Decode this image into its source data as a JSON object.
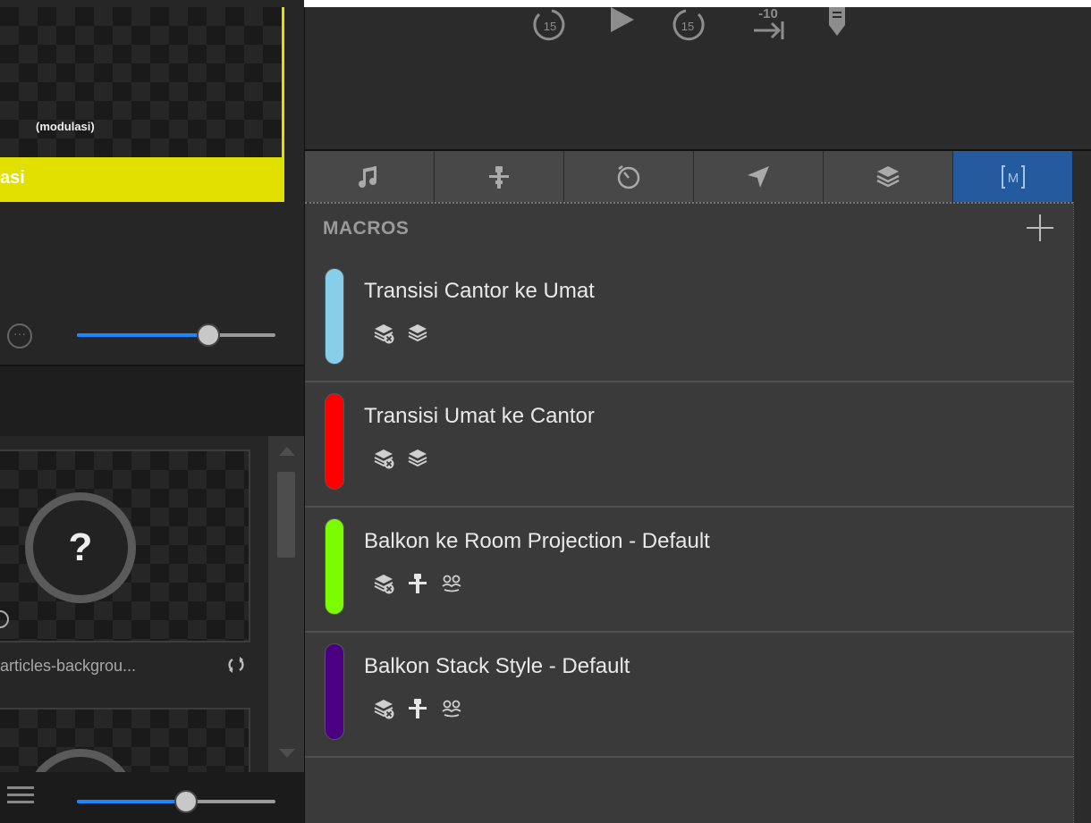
{
  "preview": {
    "caption": "(modulasi)",
    "bar_label": "asi",
    "bar_color": "#e2e000"
  },
  "sliders": {
    "top_level": 0.66,
    "bottom_level": 0.55,
    "fill_color": "#1a86ff"
  },
  "media": {
    "thumb_placeholder": "?",
    "thumb_label": "articles-backgrou...",
    "loop_icon": "loop-icon"
  },
  "transport": {
    "rewind_label": "15",
    "forward_label": "15",
    "skip_label": "-10",
    "icons": [
      "rewind-15-icon",
      "play-icon",
      "forward-15-icon",
      "skip-to-end-icon",
      "marker-icon"
    ]
  },
  "tabs": [
    {
      "id": "audio",
      "icon": "music-note-icon",
      "active": false
    },
    {
      "id": "props",
      "icon": "props-icon",
      "active": false
    },
    {
      "id": "timers",
      "icon": "timer-icon",
      "active": false
    },
    {
      "id": "messages",
      "icon": "send-icon",
      "active": false
    },
    {
      "id": "looks",
      "icon": "layers-icon",
      "active": false
    },
    {
      "id": "macros",
      "icon": "macro-icon",
      "active": true,
      "label": "M"
    }
  ],
  "macros_panel": {
    "title": "MACROS",
    "add_icon": "plus-icon",
    "items": [
      {
        "name": "Transisi Cantor ke Umat",
        "color": "#87ceeb",
        "icons": [
          "clear-layers-icon",
          "layers-icon"
        ]
      },
      {
        "name": "Transisi Umat ke Cantor",
        "color": "#ff0000",
        "icons": [
          "clear-layers-icon",
          "layers-icon"
        ]
      },
      {
        "name": "Balkon ke Room Projection - Default",
        "color": "#7cfc00",
        "icons": [
          "clear-layers-icon",
          "props-icon",
          "stage-look-icon"
        ]
      },
      {
        "name": "Balkon Stack Style - Default",
        "color": "#4b0082",
        "icons": [
          "clear-layers-icon",
          "props-icon",
          "stage-look-icon"
        ]
      }
    ]
  },
  "colors": {
    "accent": "#245b9e",
    "panel_bg": "#3a3a3a"
  }
}
